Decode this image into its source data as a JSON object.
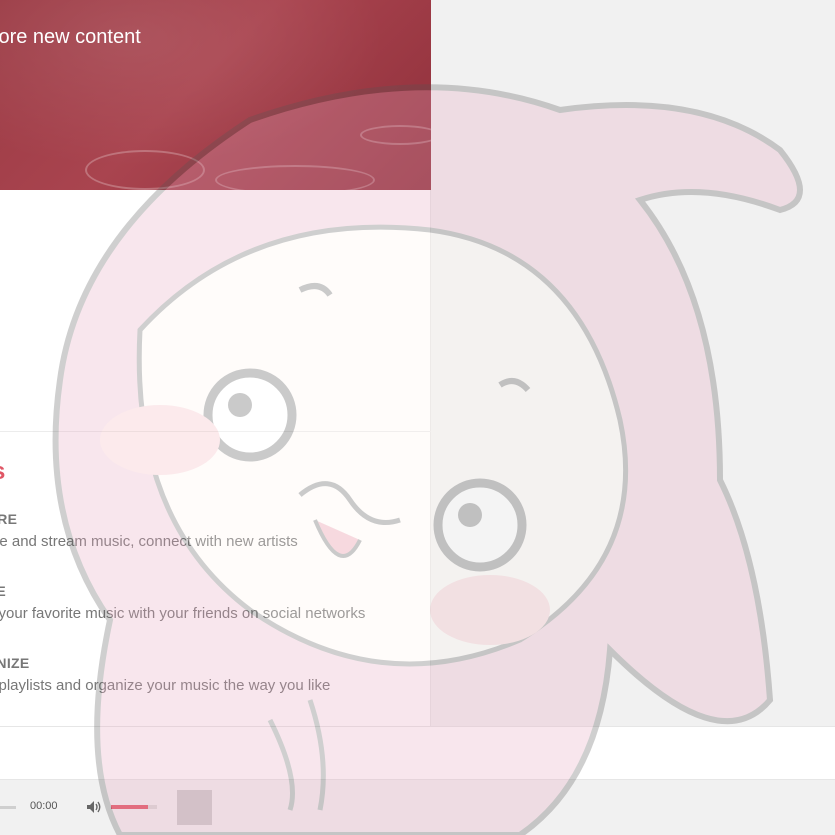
{
  "hero": {
    "title": "lore new content"
  },
  "features": {
    "heading": "s",
    "items": [
      {
        "title": "ORE",
        "description": "ore and stream music, connect with new artists"
      },
      {
        "title": "RE",
        "description": "e your favorite music with your friends on social networks"
      },
      {
        "title": "ANIZE",
        "description": "e playlists and organize your music the way you like"
      }
    ]
  },
  "search": {
    "value": ""
  },
  "player": {
    "time": "00:00",
    "volume_level": 0.8
  },
  "colors": {
    "accent": "#e05766",
    "hero": "#a9444f"
  },
  "icons": {
    "volume": "volume-icon",
    "queue": "queue-icon"
  }
}
